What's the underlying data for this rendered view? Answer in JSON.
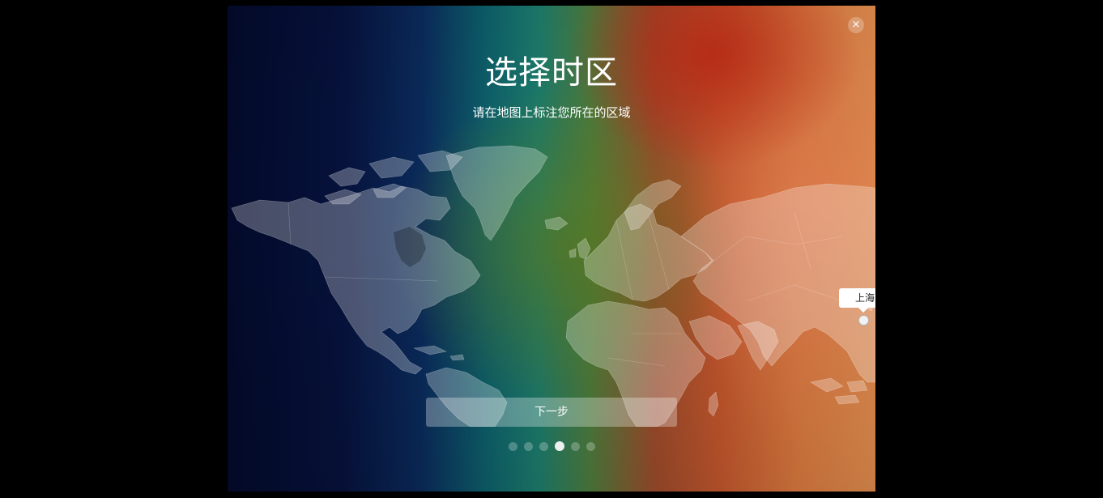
{
  "window": {
    "close_icon": "×",
    "title": "选择时区",
    "subtitle": "请在地图上标注您所在的区域"
  },
  "map": {
    "selected_city": "上海",
    "pin_icon": "location-pin-icon"
  },
  "actions": {
    "next_label": "下一步"
  },
  "pager": {
    "total_steps": 6,
    "current_step": 4
  },
  "colors": {
    "gradient_left": "#030a2a",
    "gradient_mid": "#1c7b6b",
    "gradient_right": "#dd8a4c",
    "land_overlay": "rgba(255,255,255,0.28)"
  }
}
